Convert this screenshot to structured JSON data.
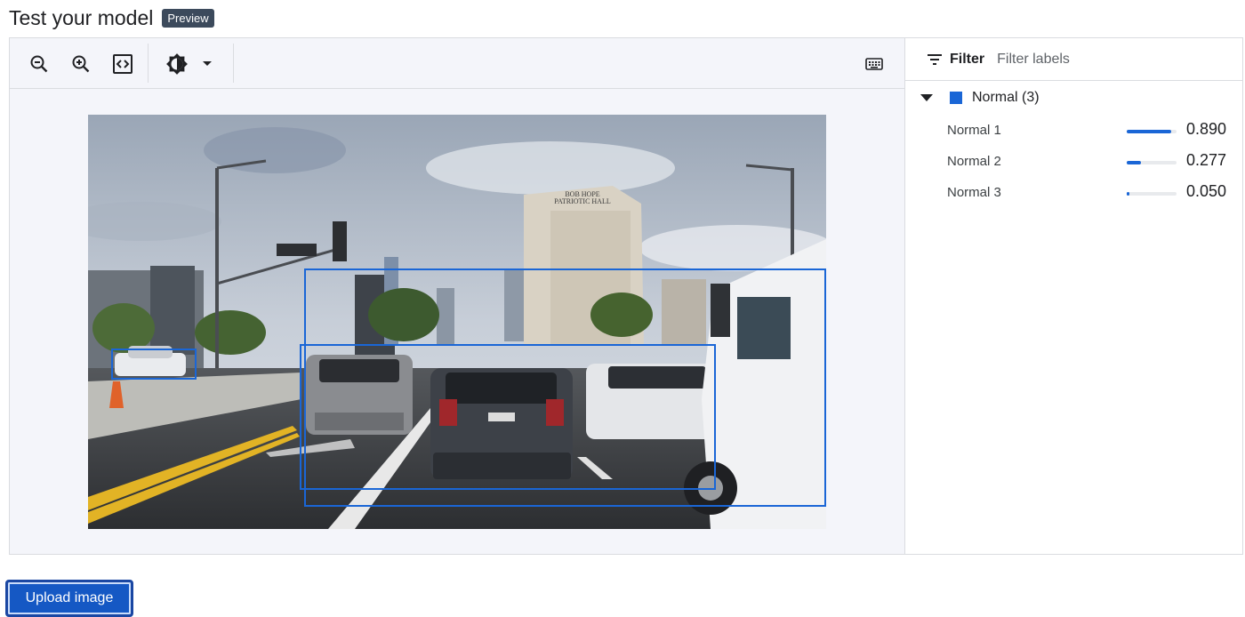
{
  "header": {
    "title": "Test your model",
    "badge": "Preview"
  },
  "toolbar": {
    "zoom_out_icon": "zoom-out-icon",
    "zoom_in_icon": "zoom-in-icon",
    "fit_icon": "fit-to-screen-icon",
    "brightness_icon": "brightness-icon",
    "dropdown_icon": "arrow-drop-down-icon",
    "keyboard_icon": "keyboard-icon"
  },
  "sidebar": {
    "filter_label": "Filter",
    "filter_placeholder": "Filter labels",
    "group_label": "Normal (3)",
    "group_color": "#1a66d6",
    "labels": [
      {
        "name": "Normal 1",
        "score": "0.890",
        "fraction": 0.89
      },
      {
        "name": "Normal 2",
        "score": "0.277",
        "fraction": 0.277
      },
      {
        "name": "Normal 3",
        "score": "0.050",
        "fraction": 0.05
      }
    ]
  },
  "actions": {
    "upload_label": "Upload image"
  },
  "colors": {
    "accent": "#1a66d6",
    "badge_bg": "#3c4a5c"
  }
}
